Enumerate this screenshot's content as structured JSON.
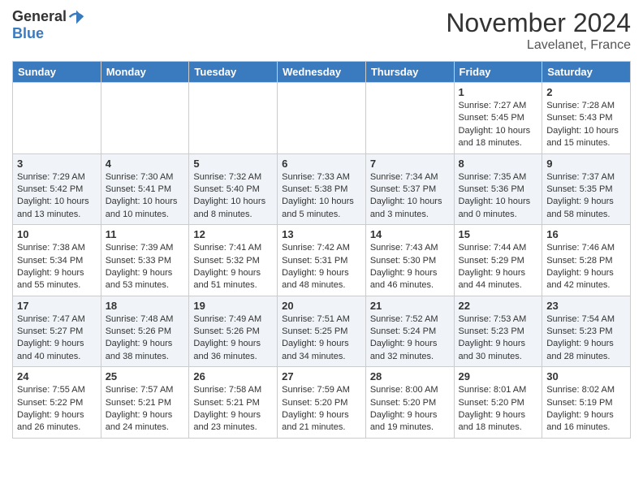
{
  "header": {
    "logo_general": "General",
    "logo_blue": "Blue",
    "month_title": "November 2024",
    "location": "Lavelanet, France"
  },
  "days_of_week": [
    "Sunday",
    "Monday",
    "Tuesday",
    "Wednesday",
    "Thursday",
    "Friday",
    "Saturday"
  ],
  "weeks": [
    [
      {
        "day": "",
        "info": ""
      },
      {
        "day": "",
        "info": ""
      },
      {
        "day": "",
        "info": ""
      },
      {
        "day": "",
        "info": ""
      },
      {
        "day": "",
        "info": ""
      },
      {
        "day": "1",
        "info": "Sunrise: 7:27 AM\nSunset: 5:45 PM\nDaylight: 10 hours and 18 minutes."
      },
      {
        "day": "2",
        "info": "Sunrise: 7:28 AM\nSunset: 5:43 PM\nDaylight: 10 hours and 15 minutes."
      }
    ],
    [
      {
        "day": "3",
        "info": "Sunrise: 7:29 AM\nSunset: 5:42 PM\nDaylight: 10 hours and 13 minutes."
      },
      {
        "day": "4",
        "info": "Sunrise: 7:30 AM\nSunset: 5:41 PM\nDaylight: 10 hours and 10 minutes."
      },
      {
        "day": "5",
        "info": "Sunrise: 7:32 AM\nSunset: 5:40 PM\nDaylight: 10 hours and 8 minutes."
      },
      {
        "day": "6",
        "info": "Sunrise: 7:33 AM\nSunset: 5:38 PM\nDaylight: 10 hours and 5 minutes."
      },
      {
        "day": "7",
        "info": "Sunrise: 7:34 AM\nSunset: 5:37 PM\nDaylight: 10 hours and 3 minutes."
      },
      {
        "day": "8",
        "info": "Sunrise: 7:35 AM\nSunset: 5:36 PM\nDaylight: 10 hours and 0 minutes."
      },
      {
        "day": "9",
        "info": "Sunrise: 7:37 AM\nSunset: 5:35 PM\nDaylight: 9 hours and 58 minutes."
      }
    ],
    [
      {
        "day": "10",
        "info": "Sunrise: 7:38 AM\nSunset: 5:34 PM\nDaylight: 9 hours and 55 minutes."
      },
      {
        "day": "11",
        "info": "Sunrise: 7:39 AM\nSunset: 5:33 PM\nDaylight: 9 hours and 53 minutes."
      },
      {
        "day": "12",
        "info": "Sunrise: 7:41 AM\nSunset: 5:32 PM\nDaylight: 9 hours and 51 minutes."
      },
      {
        "day": "13",
        "info": "Sunrise: 7:42 AM\nSunset: 5:31 PM\nDaylight: 9 hours and 48 minutes."
      },
      {
        "day": "14",
        "info": "Sunrise: 7:43 AM\nSunset: 5:30 PM\nDaylight: 9 hours and 46 minutes."
      },
      {
        "day": "15",
        "info": "Sunrise: 7:44 AM\nSunset: 5:29 PM\nDaylight: 9 hours and 44 minutes."
      },
      {
        "day": "16",
        "info": "Sunrise: 7:46 AM\nSunset: 5:28 PM\nDaylight: 9 hours and 42 minutes."
      }
    ],
    [
      {
        "day": "17",
        "info": "Sunrise: 7:47 AM\nSunset: 5:27 PM\nDaylight: 9 hours and 40 minutes."
      },
      {
        "day": "18",
        "info": "Sunrise: 7:48 AM\nSunset: 5:26 PM\nDaylight: 9 hours and 38 minutes."
      },
      {
        "day": "19",
        "info": "Sunrise: 7:49 AM\nSunset: 5:26 PM\nDaylight: 9 hours and 36 minutes."
      },
      {
        "day": "20",
        "info": "Sunrise: 7:51 AM\nSunset: 5:25 PM\nDaylight: 9 hours and 34 minutes."
      },
      {
        "day": "21",
        "info": "Sunrise: 7:52 AM\nSunset: 5:24 PM\nDaylight: 9 hours and 32 minutes."
      },
      {
        "day": "22",
        "info": "Sunrise: 7:53 AM\nSunset: 5:23 PM\nDaylight: 9 hours and 30 minutes."
      },
      {
        "day": "23",
        "info": "Sunrise: 7:54 AM\nSunset: 5:23 PM\nDaylight: 9 hours and 28 minutes."
      }
    ],
    [
      {
        "day": "24",
        "info": "Sunrise: 7:55 AM\nSunset: 5:22 PM\nDaylight: 9 hours and 26 minutes."
      },
      {
        "day": "25",
        "info": "Sunrise: 7:57 AM\nSunset: 5:21 PM\nDaylight: 9 hours and 24 minutes."
      },
      {
        "day": "26",
        "info": "Sunrise: 7:58 AM\nSunset: 5:21 PM\nDaylight: 9 hours and 23 minutes."
      },
      {
        "day": "27",
        "info": "Sunrise: 7:59 AM\nSunset: 5:20 PM\nDaylight: 9 hours and 21 minutes."
      },
      {
        "day": "28",
        "info": "Sunrise: 8:00 AM\nSunset: 5:20 PM\nDaylight: 9 hours and 19 minutes."
      },
      {
        "day": "29",
        "info": "Sunrise: 8:01 AM\nSunset: 5:20 PM\nDaylight: 9 hours and 18 minutes."
      },
      {
        "day": "30",
        "info": "Sunrise: 8:02 AM\nSunset: 5:19 PM\nDaylight: 9 hours and 16 minutes."
      }
    ]
  ]
}
